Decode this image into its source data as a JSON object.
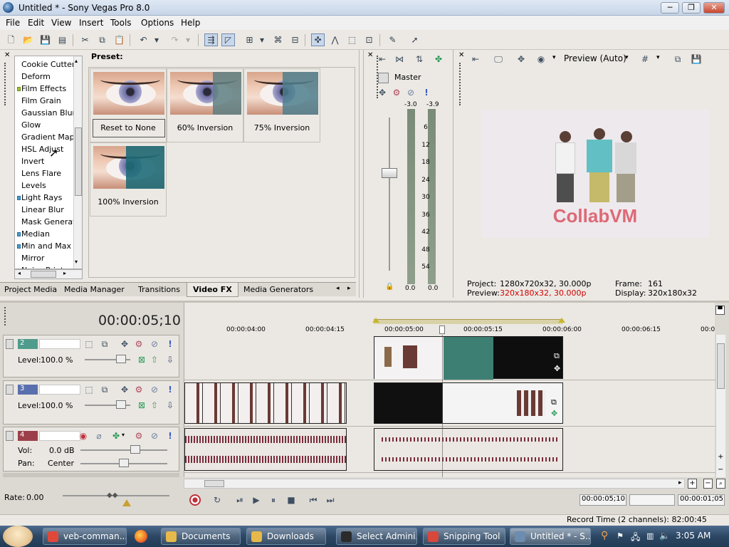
{
  "window": {
    "title": "Untitled * - Sony Vegas Pro 8.0",
    "min": "─",
    "max": "❐",
    "close": "✕"
  },
  "menu": [
    "File",
    "Edit",
    "View",
    "Insert",
    "Tools",
    "Options",
    "Help"
  ],
  "fx": {
    "header": "Preset:",
    "items": [
      {
        "label": "Cookie Cutter",
        "mark": ""
      },
      {
        "label": "Deform",
        "mark": ""
      },
      {
        "label": "Film Effects",
        "mark": "green"
      },
      {
        "label": "Film Grain",
        "mark": ""
      },
      {
        "label": "Gaussian Blur",
        "mark": ""
      },
      {
        "label": "Glow",
        "mark": ""
      },
      {
        "label": "Gradient Map",
        "mark": ""
      },
      {
        "label": "HSL Adjust",
        "mark": ""
      },
      {
        "label": "Invert",
        "mark": ""
      },
      {
        "label": "Lens Flare",
        "mark": ""
      },
      {
        "label": "Levels",
        "mark": ""
      },
      {
        "label": "Light Rays",
        "mark": "blue"
      },
      {
        "label": "Linear Blur",
        "mark": ""
      },
      {
        "label": "Mask Generator",
        "mark": ""
      },
      {
        "label": "Median",
        "mark": "blue"
      },
      {
        "label": "Min and Max",
        "mark": "blue"
      },
      {
        "label": "Mirror",
        "mark": ""
      },
      {
        "label": "Noise Print",
        "mark": ""
      }
    ],
    "presets": [
      "Reset to None",
      "60% Inversion",
      "75% Inversion",
      "100% Inversion"
    ],
    "tabs": [
      "Project Media",
      "Media Manager",
      "Transitions",
      "Video FX",
      "Media Generators"
    ],
    "active_tab": "Video FX"
  },
  "master": {
    "label": "Master",
    "peak_left": "-3.0",
    "peak_right": "-3.9",
    "scale": [
      "6",
      "12",
      "18",
      "24",
      "30",
      "36",
      "42",
      "48",
      "54"
    ],
    "level_left": "0.0",
    "level_right": "0.0"
  },
  "preview": {
    "mode": "Preview (Auto)",
    "watermark": "CollabVM",
    "project_label": "Project:",
    "project_value": "1280x720x32, 30.000p",
    "preview_label": "Preview:",
    "preview_value": "320x180x32, 30.000p",
    "frame_label": "Frame:",
    "frame_value": "161",
    "display_label": "Display:",
    "display_value": "320x180x32"
  },
  "timeline": {
    "timecode": "00:00:05;10",
    "ruler": [
      "00:00:04:00",
      "00:00:04:15",
      "00:00:05:00",
      "00:00:05:15",
      "00:00:06:00",
      "00:00:06:15",
      "00:0"
    ],
    "tracks": [
      {
        "num": "2",
        "kind": "video",
        "level_label": "Level:",
        "level": "100.0 %",
        "color": "#4f9b8c"
      },
      {
        "num": "3",
        "kind": "video",
        "level_label": "Level:",
        "level": "100.0 %",
        "color": "#5a6fae"
      },
      {
        "num": "4",
        "kind": "audio",
        "vol_label": "Vol:",
        "vol": "0.0 dB",
        "pan_label": "Pan:",
        "pan": "Center",
        "color": "#9c3f4a"
      }
    ],
    "rate_label": "Rate:",
    "rate": "0.00",
    "pos_timecode": "00:00:05;10",
    "len_timecode": "00:00:01;05",
    "record_time": "Record Time (2 channels): 82:00:45"
  },
  "taskbar": {
    "buttons": [
      {
        "label": "veb-comman...",
        "color": "#e0493a"
      },
      {
        "label": "Documents",
        "color": "#e6b94a"
      },
      {
        "label": "Downloads",
        "color": "#e6b94a"
      },
      {
        "label": "Select Admini...",
        "color": "#2b2b2b"
      },
      {
        "label": "Snipping Tool",
        "color": "#d7473b"
      },
      {
        "label": "Untitled * - S...",
        "color": "#6c8cb0"
      }
    ],
    "clock": "3:05 AM"
  }
}
